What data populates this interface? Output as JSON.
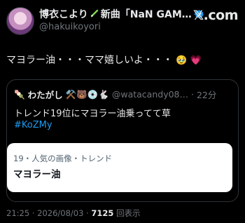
{
  "author": {
    "name": "博衣こより",
    "name_suffix": "新曲「NaN GAM…",
    "handle": "@hakuikoyori",
    "pen_icon": "green-pen",
    "verified": true
  },
  "brand": "𝕏.com",
  "tweet": {
    "text": "マヨラー油・・・ママ嬉しいよ・・・",
    "emoji": "🥹",
    "heart": "💗"
  },
  "quote": {
    "author_name": "わたがし",
    "author_emojis": "⚒️🐻💿🐇",
    "prefix_emoji": "🍡",
    "handle": "@watacandy08…",
    "time": "22分",
    "text": "トレンド19位にマヨラー油乗ってて草",
    "hashtag": "#KoZMy",
    "card": {
      "meta": "19・人気の画像・トレンド",
      "title": "マヨラー油"
    }
  },
  "footer": {
    "time": "21:25",
    "date": "2026/08/03",
    "views": "7125",
    "views_label": "回表示"
  },
  "colors": {
    "accent": "#1d9bf0",
    "verified": "#1d9bf0",
    "muted": "#71767b"
  }
}
